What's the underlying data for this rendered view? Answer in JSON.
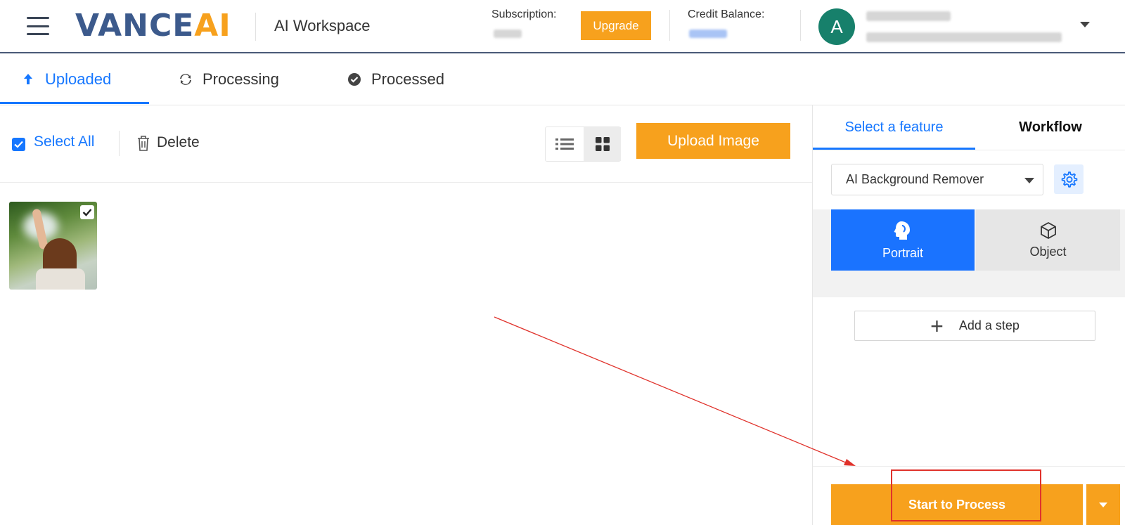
{
  "header": {
    "logo_part1": "VANCE",
    "logo_part2": "AI",
    "workspace_title": "AI Workspace",
    "subscription_label": "Subscription:",
    "upgrade_label": "Upgrade",
    "credit_label": "Credit Balance:",
    "avatar_letter": "A"
  },
  "tabs": [
    {
      "label": "Uploaded",
      "icon": "upload-arrow-icon",
      "active": true
    },
    {
      "label": "Processing",
      "icon": "refresh-icon",
      "active": false
    },
    {
      "label": "Processed",
      "icon": "check-circle-icon",
      "active": false
    }
  ],
  "toolbar": {
    "select_all_label": "Select All",
    "delete_label": "Delete",
    "upload_label": "Upload Image",
    "view_mode": "grid"
  },
  "panel": {
    "tabs": [
      {
        "label": "Select a feature",
        "active": true
      },
      {
        "label": "Workflow",
        "active": false
      }
    ],
    "feature_select": "AI Background Remover",
    "modes": [
      {
        "label": "Portrait",
        "icon": "portrait-head-icon",
        "selected": true
      },
      {
        "label": "Object",
        "icon": "cube-icon",
        "selected": false
      }
    ],
    "add_step_label": "Add a step",
    "start_label": "Start to Process"
  },
  "colors": {
    "accent_blue": "#1677ff",
    "orange": "#f7a11d",
    "logo_blue": "#3c5a8c",
    "avatar_green": "#17806b",
    "annotation_red": "#e0322b"
  }
}
